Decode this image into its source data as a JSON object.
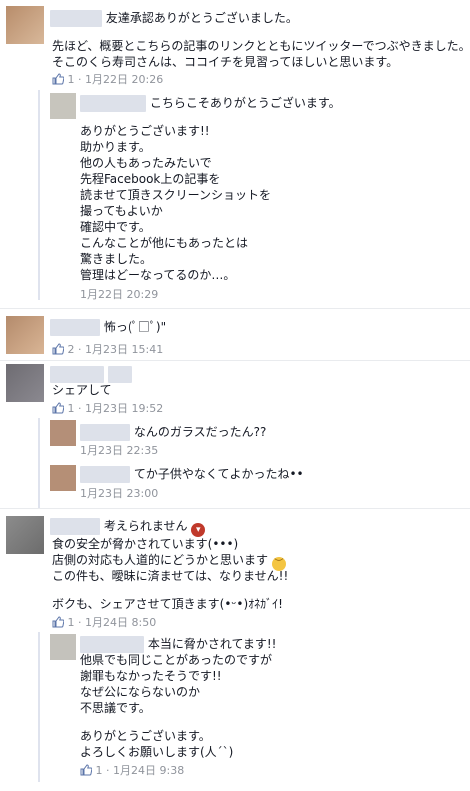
{
  "c1": {
    "name_suffix": "友達承認ありがとうございました。",
    "body": [
      "先ほど、概要とこちらの記事のリンクとともにツイッターでつぶやきました。",
      "そこのくら寿司さんは、ココイチを見習ってほしいと思います。"
    ],
    "likes": "1",
    "date": "1月22日 20:26",
    "reply": {
      "name_suffix": "こちらこそありがとうございます。",
      "body": [
        "ありがとうございます!!",
        "助かります。",
        "他の人もあったみたいで",
        "先程Facebook上の記事を",
        "読ませて頂きスクリーンショットを",
        "撮ってもよいか",
        "確認中です。",
        "こんなことが他にもあったとは",
        "驚きました。",
        "管理はどーなってるのか…。"
      ],
      "date": "1月22日 20:29"
    }
  },
  "c2": {
    "name_suffix": "怖っ(ﾟ□ﾟ)\"",
    "likes": "2",
    "date": "1月23日 15:41"
  },
  "c3": {
    "body": "シェアして",
    "likes": "1",
    "date": "1月23日 19:52",
    "reply1": {
      "text": "なんのガラスだったん??",
      "date": "1月23日 22:35"
    },
    "reply2": {
      "text": "てか子供やなくてよかったね••",
      "date": "1月23日 23:00"
    }
  },
  "c4": {
    "name_suffix": "考えられません",
    "body": [
      "食の安全が脅かされています(•••)",
      "店側の対応も人道的にどうかと思います",
      "この件も、曖昧に済ませては、なりません!!",
      "",
      "ボクも、シェアさせて頂きます(•ᵕ•)ｵﾈｶﾞｲ!"
    ],
    "likes": "1",
    "date": "1月24日 8:50",
    "reply": {
      "name_suffix": "本当に脅かされてます!!",
      "body": [
        "他県でも同じことがあったのですが",
        "謝罪もなかったそうです!!",
        "なぜ公にならないのか",
        "不思議です。",
        "",
        "ありがとうございます。",
        "よろしくお願いします(人´`)"
      ],
      "likes": "1",
      "date": "1月24日 9:38"
    }
  },
  "colors": {
    "link": "#3b5998",
    "meta": "#90949c",
    "reply_bar": "#dfe3ee"
  }
}
